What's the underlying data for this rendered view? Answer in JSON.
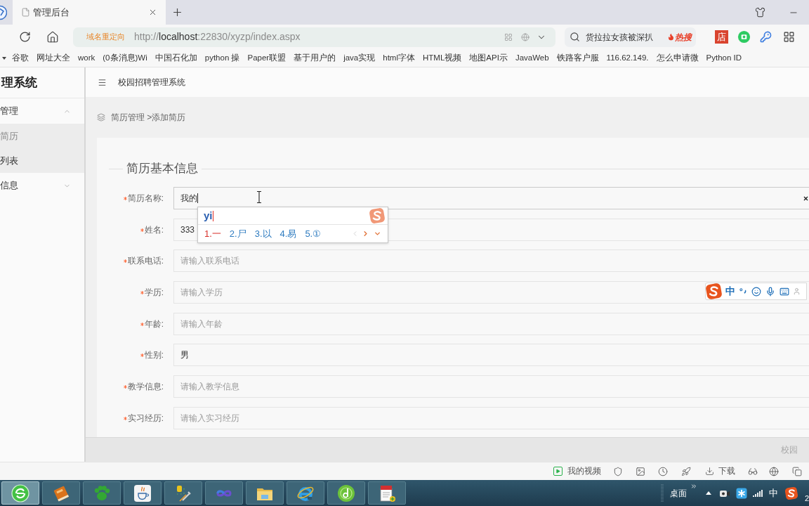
{
  "browser": {
    "tab": {
      "title": "管理后台"
    },
    "address_bar": {
      "redirect_label": "域名重定向",
      "url_scheme": "http://",
      "url_host": "localhost",
      "url_path": ":22830/xyzp/index.aspx"
    },
    "search_box": {
      "value": "货拉拉女孩被深扒",
      "hot_label": "热搜"
    },
    "extension_badge": "店",
    "bookmarks": [
      "谷歌",
      "网址大全",
      "work",
      "(0条消息)Wi",
      "中国石化加",
      "python 操",
      "Paper联盟",
      "基于用户的",
      "java实现",
      "html字体",
      "HTML视频",
      "地图API示",
      "JavaWeb",
      "铁路客户服",
      "116.62.149.",
      "怎么申请微",
      "Python ID"
    ]
  },
  "sidebar": {
    "title": "理系统",
    "items": [
      {
        "label": "管理",
        "expanded": true,
        "children": [
          {
            "label": "简历",
            "selected": true
          },
          {
            "label": "列表",
            "selected": false
          }
        ]
      },
      {
        "label": "信息",
        "expanded": false
      }
    ]
  },
  "header": {
    "title": "校园招聘管理系统"
  },
  "breadcrumb": {
    "text": "简历管理 >添加简历"
  },
  "form": {
    "legend": "简历基本信息",
    "fields": [
      {
        "label": "简历名称:",
        "required": true,
        "value": "我的",
        "focused": true
      },
      {
        "label": "姓名:",
        "required": true,
        "value": "333",
        "focused": false
      },
      {
        "label": "联系电话:",
        "required": true,
        "placeholder": "请输入联系电话",
        "focused": false
      },
      {
        "label": "学历:",
        "required": true,
        "placeholder": "请输入学历",
        "focused": false
      },
      {
        "label": "年龄:",
        "required": true,
        "placeholder": "请输入年龄",
        "focused": false
      },
      {
        "label": "性别:",
        "required": true,
        "value": "男",
        "focused": false
      },
      {
        "label": "教学信息:",
        "required": true,
        "placeholder": "请输入教学信息",
        "focused": false
      },
      {
        "label": "实习经历:",
        "required": true,
        "placeholder": "请输入实习经历",
        "focused": false
      }
    ]
  },
  "ime_popup": {
    "composition": "yi",
    "candidates": [
      {
        "text": "1.一",
        "selected": true
      },
      {
        "text": "2.尸",
        "selected": false
      },
      {
        "text": "3.以",
        "selected": false
      },
      {
        "text": "4.易",
        "selected": false
      },
      {
        "text": "5.①",
        "selected": false
      }
    ]
  },
  "ime_toolbar": {
    "mode": "中"
  },
  "footer": {
    "text": "校园"
  },
  "status_bar": {
    "video_label": "我的视频",
    "download_label": "下载"
  },
  "taskbar": {
    "apps": [
      {
        "kind": "browser",
        "selected": true
      },
      {
        "kind": "book",
        "selected": false
      },
      {
        "kind": "paw",
        "selected": false
      },
      {
        "kind": "java",
        "selected": false
      },
      {
        "kind": "tools",
        "selected": false
      },
      {
        "kind": "infinity",
        "selected": false
      },
      {
        "kind": "folder",
        "selected": false
      },
      {
        "kind": "ie",
        "selected": false
      },
      {
        "kind": "disc",
        "selected": false
      },
      {
        "kind": "notepad",
        "selected": false
      }
    ],
    "desktop_label": "桌面",
    "ime_indicator": "中",
    "clock": "2"
  }
}
